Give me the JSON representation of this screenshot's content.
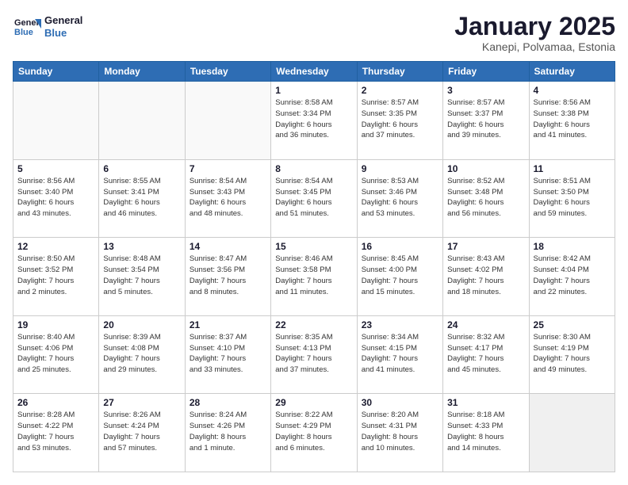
{
  "header": {
    "logo_line1": "General",
    "logo_line2": "Blue",
    "month": "January 2025",
    "location": "Kanepi, Polvamaa, Estonia"
  },
  "weekdays": [
    "Sunday",
    "Monday",
    "Tuesday",
    "Wednesday",
    "Thursday",
    "Friday",
    "Saturday"
  ],
  "weeks": [
    [
      {
        "day": "",
        "info": ""
      },
      {
        "day": "",
        "info": ""
      },
      {
        "day": "",
        "info": ""
      },
      {
        "day": "1",
        "info": "Sunrise: 8:58 AM\nSunset: 3:34 PM\nDaylight: 6 hours\nand 36 minutes."
      },
      {
        "day": "2",
        "info": "Sunrise: 8:57 AM\nSunset: 3:35 PM\nDaylight: 6 hours\nand 37 minutes."
      },
      {
        "day": "3",
        "info": "Sunrise: 8:57 AM\nSunset: 3:37 PM\nDaylight: 6 hours\nand 39 minutes."
      },
      {
        "day": "4",
        "info": "Sunrise: 8:56 AM\nSunset: 3:38 PM\nDaylight: 6 hours\nand 41 minutes."
      }
    ],
    [
      {
        "day": "5",
        "info": "Sunrise: 8:56 AM\nSunset: 3:40 PM\nDaylight: 6 hours\nand 43 minutes."
      },
      {
        "day": "6",
        "info": "Sunrise: 8:55 AM\nSunset: 3:41 PM\nDaylight: 6 hours\nand 46 minutes."
      },
      {
        "day": "7",
        "info": "Sunrise: 8:54 AM\nSunset: 3:43 PM\nDaylight: 6 hours\nand 48 minutes."
      },
      {
        "day": "8",
        "info": "Sunrise: 8:54 AM\nSunset: 3:45 PM\nDaylight: 6 hours\nand 51 minutes."
      },
      {
        "day": "9",
        "info": "Sunrise: 8:53 AM\nSunset: 3:46 PM\nDaylight: 6 hours\nand 53 minutes."
      },
      {
        "day": "10",
        "info": "Sunrise: 8:52 AM\nSunset: 3:48 PM\nDaylight: 6 hours\nand 56 minutes."
      },
      {
        "day": "11",
        "info": "Sunrise: 8:51 AM\nSunset: 3:50 PM\nDaylight: 6 hours\nand 59 minutes."
      }
    ],
    [
      {
        "day": "12",
        "info": "Sunrise: 8:50 AM\nSunset: 3:52 PM\nDaylight: 7 hours\nand 2 minutes."
      },
      {
        "day": "13",
        "info": "Sunrise: 8:48 AM\nSunset: 3:54 PM\nDaylight: 7 hours\nand 5 minutes."
      },
      {
        "day": "14",
        "info": "Sunrise: 8:47 AM\nSunset: 3:56 PM\nDaylight: 7 hours\nand 8 minutes."
      },
      {
        "day": "15",
        "info": "Sunrise: 8:46 AM\nSunset: 3:58 PM\nDaylight: 7 hours\nand 11 minutes."
      },
      {
        "day": "16",
        "info": "Sunrise: 8:45 AM\nSunset: 4:00 PM\nDaylight: 7 hours\nand 15 minutes."
      },
      {
        "day": "17",
        "info": "Sunrise: 8:43 AM\nSunset: 4:02 PM\nDaylight: 7 hours\nand 18 minutes."
      },
      {
        "day": "18",
        "info": "Sunrise: 8:42 AM\nSunset: 4:04 PM\nDaylight: 7 hours\nand 22 minutes."
      }
    ],
    [
      {
        "day": "19",
        "info": "Sunrise: 8:40 AM\nSunset: 4:06 PM\nDaylight: 7 hours\nand 25 minutes."
      },
      {
        "day": "20",
        "info": "Sunrise: 8:39 AM\nSunset: 4:08 PM\nDaylight: 7 hours\nand 29 minutes."
      },
      {
        "day": "21",
        "info": "Sunrise: 8:37 AM\nSunset: 4:10 PM\nDaylight: 7 hours\nand 33 minutes."
      },
      {
        "day": "22",
        "info": "Sunrise: 8:35 AM\nSunset: 4:13 PM\nDaylight: 7 hours\nand 37 minutes."
      },
      {
        "day": "23",
        "info": "Sunrise: 8:34 AM\nSunset: 4:15 PM\nDaylight: 7 hours\nand 41 minutes."
      },
      {
        "day": "24",
        "info": "Sunrise: 8:32 AM\nSunset: 4:17 PM\nDaylight: 7 hours\nand 45 minutes."
      },
      {
        "day": "25",
        "info": "Sunrise: 8:30 AM\nSunset: 4:19 PM\nDaylight: 7 hours\nand 49 minutes."
      }
    ],
    [
      {
        "day": "26",
        "info": "Sunrise: 8:28 AM\nSunset: 4:22 PM\nDaylight: 7 hours\nand 53 minutes."
      },
      {
        "day": "27",
        "info": "Sunrise: 8:26 AM\nSunset: 4:24 PM\nDaylight: 7 hours\nand 57 minutes."
      },
      {
        "day": "28",
        "info": "Sunrise: 8:24 AM\nSunset: 4:26 PM\nDaylight: 8 hours\nand 1 minute."
      },
      {
        "day": "29",
        "info": "Sunrise: 8:22 AM\nSunset: 4:29 PM\nDaylight: 8 hours\nand 6 minutes."
      },
      {
        "day": "30",
        "info": "Sunrise: 8:20 AM\nSunset: 4:31 PM\nDaylight: 8 hours\nand 10 minutes."
      },
      {
        "day": "31",
        "info": "Sunrise: 8:18 AM\nSunset: 4:33 PM\nDaylight: 8 hours\nand 14 minutes."
      },
      {
        "day": "",
        "info": ""
      }
    ]
  ]
}
